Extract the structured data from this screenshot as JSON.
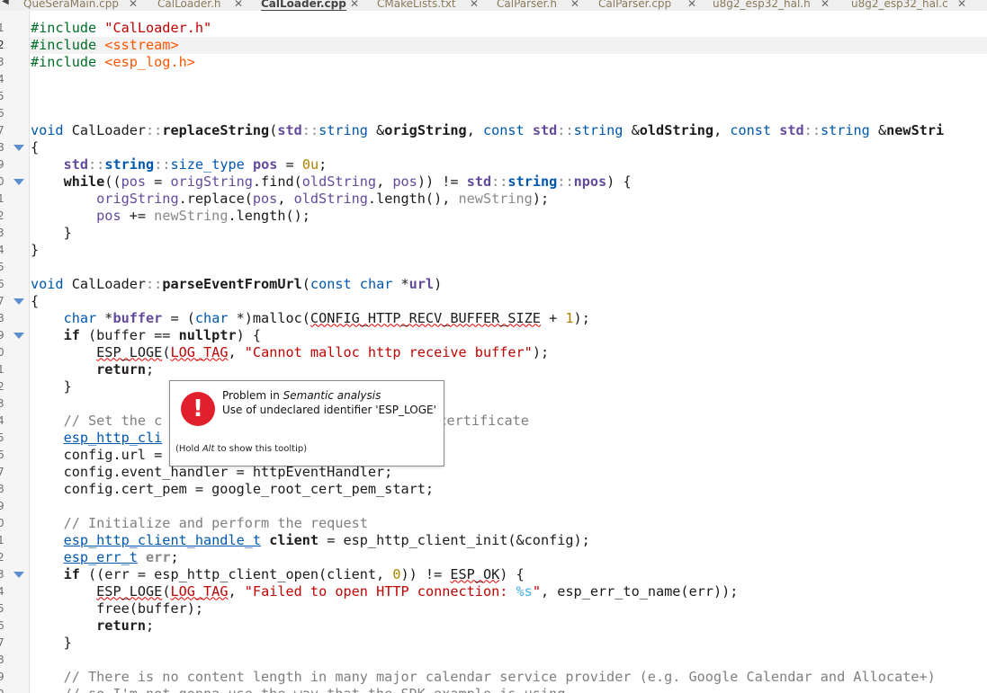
{
  "tabs": [
    {
      "label": "QueSeraMain.cpp",
      "active": false
    },
    {
      "label": "CalLoader.h",
      "active": false
    },
    {
      "label": "CalLoader.cpp",
      "active": true
    },
    {
      "label": "CMakeLists.txt",
      "active": false
    },
    {
      "label": "CalParser.h",
      "active": false
    },
    {
      "label": "CalParser.cpp",
      "active": false
    },
    {
      "label": "u8g2_esp32_hal.h",
      "active": false
    },
    {
      "label": "u8g2_esp32_hal.c",
      "active": false
    }
  ],
  "tab_close_glyph": "✕",
  "line_numbers": [
    "1",
    "2",
    "3",
    "4",
    "5",
    "6",
    "7",
    "8",
    "9",
    "0",
    "1",
    "2",
    "3",
    "4",
    "5",
    "6",
    "7",
    "8",
    "9",
    "0",
    "1",
    "2",
    "3",
    "4",
    "5",
    "6",
    "7",
    "8",
    "9",
    "0",
    "1",
    "2",
    "3",
    "4",
    "5",
    "6",
    "7",
    "8",
    "9",
    "0"
  ],
  "current_line": "2",
  "fold_lines": [
    8,
    10,
    17,
    19,
    33
  ],
  "code": {
    "l1a": "#include ",
    "l1b": "\"CalLoader.h\"",
    "l2a": "#include ",
    "l2b": "<sstream>",
    "l3a": "#include ",
    "l3b": "<esp_log.h>",
    "l7a": "void ",
    "l7b": "CalLoader",
    "l7c": "::",
    "l7d": "replaceString",
    "l7e": "(",
    "l7f": "std",
    "l7g": "::",
    "l7h": "string",
    "l7i": " &",
    "l7j": "origString",
    "l7k": ", ",
    "l7l": "const ",
    "l7m": "std",
    "l7n": "::",
    "l7o": "string",
    "l7p": " &",
    "l7q": "oldString",
    "l7r": ", ",
    "l7s": "const ",
    "l7t": "std",
    "l7u": "::",
    "l7v": "string",
    "l7w": " &",
    "l7x": "newStri",
    "l8": "{",
    "l9a": "    ",
    "l9b": "std",
    "l9c": "::",
    "l9d": "string",
    "l9e": "::",
    "l9f": "size_type",
    "l9g": " ",
    "l9h": "pos",
    "l9i": " = ",
    "l9j": "0u",
    "l9k": ";",
    "l10a": "    ",
    "l10b": "while",
    "l10c": "((",
    "l10d": "pos",
    "l10e": " = ",
    "l10f": "origString",
    "l10g": ".find(",
    "l10h": "oldString",
    "l10i": ", ",
    "l10j": "pos",
    "l10k": ")) != ",
    "l10l": "std",
    "l10m": "::",
    "l10n": "string",
    "l10o": "::",
    "l10p": "npos",
    "l10q": ") {",
    "l11a": "        ",
    "l11b": "origString",
    "l11c": ".replace(",
    "l11d": "pos",
    "l11e": ", ",
    "l11f": "oldString",
    "l11g": ".length(), ",
    "l11h": "newString",
    "l11i": ");",
    "l12a": "        ",
    "l12b": "pos",
    "l12c": " += ",
    "l12d": "newString",
    "l12e": ".length();",
    "l13": "    }",
    "l14": "}",
    "l16a": "void ",
    "l16b": "CalLoader",
    "l16c": "::",
    "l16d": "parseEventFromUrl",
    "l16e": "(",
    "l16f": "const ",
    "l16g": "char",
    "l16h": " *",
    "l16i": "url",
    "l16j": ")",
    "l17": "{",
    "l18a": "    ",
    "l18b": "char",
    "l18c": " *",
    "l18d": "buffer",
    "l18e": " = (",
    "l18f": "char",
    "l18g": " *)malloc(",
    "l18h": "CONFIG_HTTP_RECV_BUFFER_SIZE",
    "l18i": " + ",
    "l18j": "1",
    "l18k": ");",
    "l19a": "    ",
    "l19b": "if",
    "l19c": " (buffer == ",
    "l19d": "nullptr",
    "l19e": ") {",
    "l20a": "        ",
    "l20b": "ESP_LOGE",
    "l20c": "(",
    "l20d": "LOG_TAG",
    "l20e": ", ",
    "l20f": "\"Cannot malloc http receive buffer\"",
    "l20g": ");",
    "l21a": "        ",
    "l21b": "return",
    "l21c": ";",
    "l22": "    }",
    "l24a": "    ",
    "l24b": "// Set the c",
    "l24c": "certificate",
    "l25a": "    ",
    "l25b": "esp_http_cli",
    "l26a": "    ",
    "l26b": "config.url =",
    "l27a": "    ",
    "l27b": "config.event_handler = httpEventHandler;",
    "l28a": "    ",
    "l28b": "config.cert_pem = google_root_cert_pem_start;",
    "l30a": "    ",
    "l30b": "// Initialize and perform the request",
    "l31a": "    ",
    "l31b": "esp_http_client_handle_t",
    "l31c": " ",
    "l31d": "client",
    "l31e": " = esp_http_client_init(&config);",
    "l32a": "    ",
    "l32b": "esp_err_t",
    "l32c": " ",
    "l32d": "err",
    "l32e": ";",
    "l33a": "    ",
    "l33b": "if",
    "l33c": " ((err = esp_http_client_open(client, ",
    "l33d": "0",
    "l33e": ")) != ",
    "l33f": "ESP_OK",
    "l33g": ") {",
    "l34a": "        ",
    "l34b": "ESP_LOGE",
    "l34c": "(",
    "l34d": "LOG_TAG",
    "l34e": ", ",
    "l34f": "\"Failed to open HTTP connection: ",
    "l34g": "%s",
    "l34h": "\"",
    "l34i": ", esp_err_to_name(err));",
    "l35a": "        ",
    "l35b": "free(buffer);",
    "l36a": "        ",
    "l36b": "return",
    "l36c": ";",
    "l37": "    }",
    "l39a": "    ",
    "l39b": "// There is no content length in many major calendar service provider (e.g. Google Calendar and Allocate+)",
    "l40a": "    ",
    "l40b": "// so I'm not gonna use the way that the SDK example is using"
  },
  "tooltip": {
    "icon": "!",
    "line1_prefix": "Problem in ",
    "line1_em": "Semantic analysis",
    "line2": "Use of undeclared identifier 'ESP_LOGE'",
    "hint_prefix": "(Hold ",
    "hint_key": "Alt",
    "hint_suffix": " to show this tooltip)"
  },
  "colors": {
    "error_icon": "#e0212d",
    "fold_marker": "#5b8fd0",
    "type": "#0057ae",
    "namespace": "#644a9b",
    "string": "#bf0303",
    "include": "#ff5500",
    "number": "#b08000",
    "comment": "#7f7f7f"
  }
}
